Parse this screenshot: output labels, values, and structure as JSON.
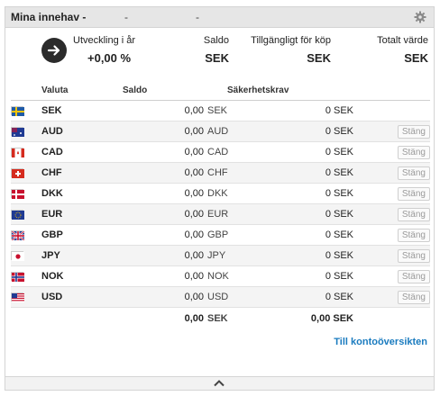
{
  "header": {
    "title": "Mina innehav -",
    "dash1": "-",
    "dash2": "-"
  },
  "summary": {
    "development_label": "Utveckling i år",
    "development_value": "+0,00 %",
    "saldo_label": "Saldo",
    "saldo_value": "SEK",
    "available_label": "Tillgängligt för köp",
    "available_value": "SEK",
    "total_label": "Totalt värde",
    "total_value": "SEK"
  },
  "table": {
    "headers": {
      "currency": "Valuta",
      "saldo": "Saldo",
      "margin": "Säkerhetskrav"
    },
    "close_label": "Stäng",
    "rows": [
      {
        "code": "SEK",
        "flag": "sweden-flag-icon",
        "saldo": "0,00",
        "saldo_unit": "SEK",
        "margin": "0 SEK",
        "closable": false
      },
      {
        "code": "AUD",
        "flag": "australia-flag-icon",
        "saldo": "0,00",
        "saldo_unit": "AUD",
        "margin": "0 SEK",
        "closable": true
      },
      {
        "code": "CAD",
        "flag": "canada-flag-icon",
        "saldo": "0,00",
        "saldo_unit": "CAD",
        "margin": "0 SEK",
        "closable": true
      },
      {
        "code": "CHF",
        "flag": "switzerland-flag-icon",
        "saldo": "0,00",
        "saldo_unit": "CHF",
        "margin": "0 SEK",
        "closable": true
      },
      {
        "code": "DKK",
        "flag": "denmark-flag-icon",
        "saldo": "0,00",
        "saldo_unit": "DKK",
        "margin": "0 SEK",
        "closable": true
      },
      {
        "code": "EUR",
        "flag": "eu-flag-icon",
        "saldo": "0,00",
        "saldo_unit": "EUR",
        "margin": "0 SEK",
        "closable": true
      },
      {
        "code": "GBP",
        "flag": "uk-flag-icon",
        "saldo": "0,00",
        "saldo_unit": "GBP",
        "margin": "0 SEK",
        "closable": true
      },
      {
        "code": "JPY",
        "flag": "japan-flag-icon",
        "saldo": "0,00",
        "saldo_unit": "JPY",
        "margin": "0 SEK",
        "closable": true
      },
      {
        "code": "NOK",
        "flag": "norway-flag-icon",
        "saldo": "0,00",
        "saldo_unit": "NOK",
        "margin": "0 SEK",
        "closable": true
      },
      {
        "code": "USD",
        "flag": "usa-flag-icon",
        "saldo": "0,00",
        "saldo_unit": "USD",
        "margin": "0 SEK",
        "closable": true
      }
    ],
    "total": {
      "saldo": "0,00",
      "saldo_unit": "SEK",
      "margin": "0,00 SEK"
    }
  },
  "links": {
    "account_overview": "Till kontoöversikten"
  },
  "icons": {
    "settings": "gear-icon",
    "development": "arrow-right-circle-icon",
    "collapse": "chevron-up-icon"
  },
  "colors": {
    "link": "#1a7bbf",
    "header_bg": "#e6e6e6"
  }
}
